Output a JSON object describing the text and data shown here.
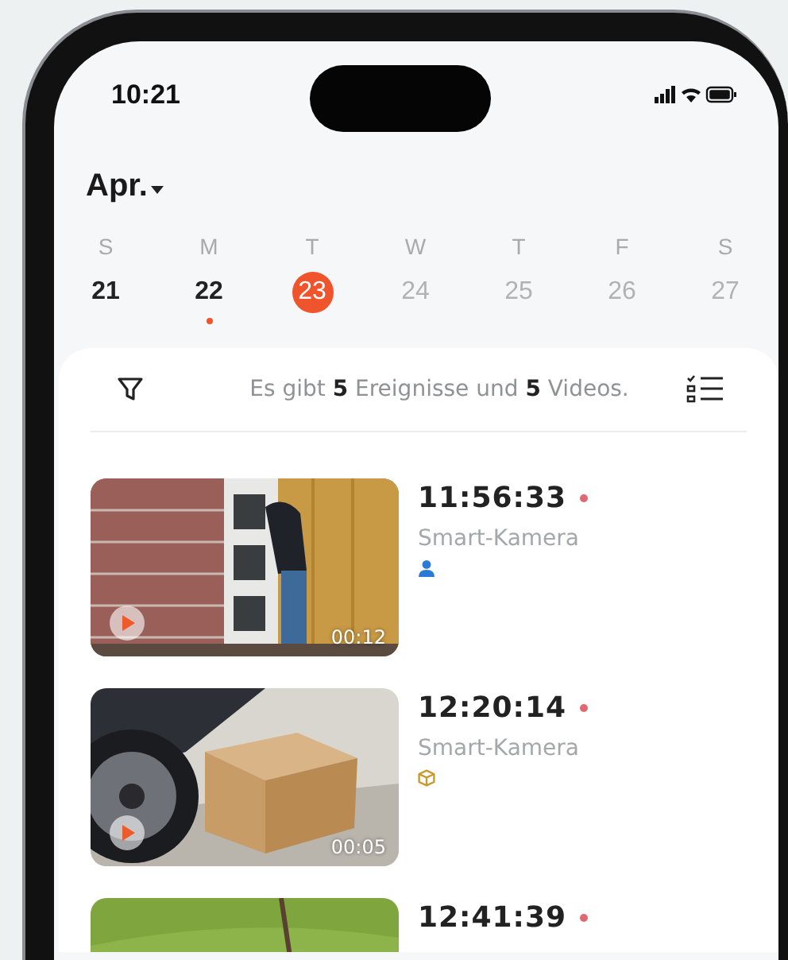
{
  "status_bar": {
    "time": "10:21"
  },
  "month": {
    "label": "Apr."
  },
  "week": [
    {
      "weekday": "S",
      "date": "21",
      "selected": false,
      "future": false,
      "has_events": false
    },
    {
      "weekday": "M",
      "date": "22",
      "selected": false,
      "future": false,
      "has_events": true
    },
    {
      "weekday": "T",
      "date": "23",
      "selected": true,
      "future": false,
      "has_events": false
    },
    {
      "weekday": "W",
      "date": "24",
      "selected": false,
      "future": true,
      "has_events": false
    },
    {
      "weekday": "T",
      "date": "25",
      "selected": false,
      "future": true,
      "has_events": false
    },
    {
      "weekday": "F",
      "date": "26",
      "selected": false,
      "future": true,
      "has_events": false
    },
    {
      "weekday": "S",
      "date": "27",
      "selected": false,
      "future": true,
      "has_events": false
    }
  ],
  "summary": "Es gibt **5** Ereignisse und **5** Videos.",
  "events": [
    {
      "time": "11:56:33",
      "source": "Smart-Kamera",
      "kind": "person",
      "duration": "00:12"
    },
    {
      "time": "12:20:14",
      "source": "Smart-Kamera",
      "kind": "package",
      "duration": "00:05"
    },
    {
      "time": "12:41:39"
    }
  ]
}
